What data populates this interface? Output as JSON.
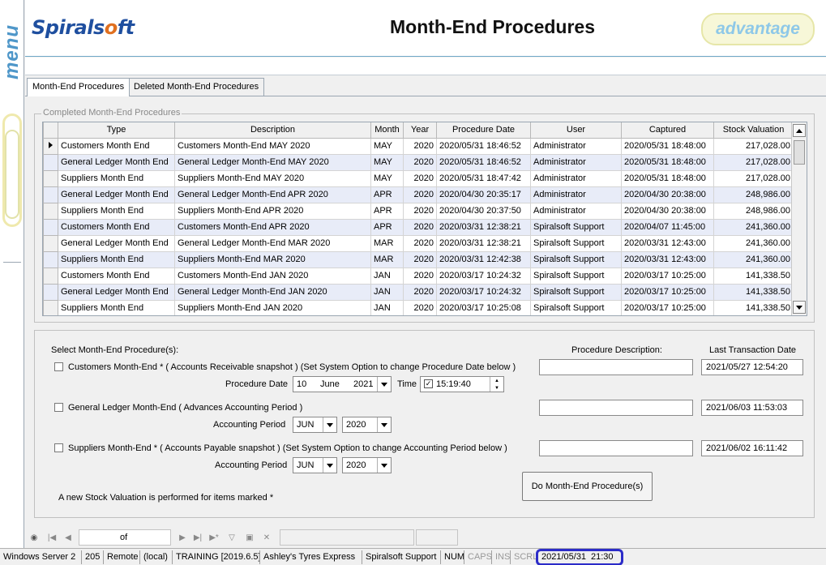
{
  "side_menu": {
    "label": "menu"
  },
  "header": {
    "logo_text_1": "Spirals",
    "logo_text_o": "o",
    "logo_text_2": "ft",
    "title": "Month-End Procedures",
    "right_logo": "advantage"
  },
  "tabs": [
    {
      "label": "Month-End Procedures",
      "active": true
    },
    {
      "label": "Deleted Month-End Procedures",
      "active": false
    }
  ],
  "completed": {
    "group_label": "Completed Month-End Procedures",
    "columns": [
      "Type",
      "Description",
      "Month",
      "Year",
      "Procedure Date",
      "User",
      "Captured",
      "Stock Valuation"
    ],
    "rows": [
      [
        "Customers Month End",
        "Customers Month-End MAY 2020",
        "MAY",
        "2020",
        "2020/05/31 18:46:52",
        "Administrator",
        "2020/05/31 18:48:00",
        "217,028.00"
      ],
      [
        "General Ledger Month End",
        "General Ledger Month-End MAY 2020",
        "MAY",
        "2020",
        "2020/05/31 18:46:52",
        "Administrator",
        "2020/05/31 18:48:00",
        "217,028.00"
      ],
      [
        "Suppliers Month End",
        "Suppliers Month-End MAY 2020",
        "MAY",
        "2020",
        "2020/05/31 18:47:42",
        "Administrator",
        "2020/05/31 18:48:00",
        "217,028.00"
      ],
      [
        "General Ledger Month End",
        "General Ledger Month-End APR 2020",
        "APR",
        "2020",
        "2020/04/30 20:35:17",
        "Administrator",
        "2020/04/30 20:38:00",
        "248,986.00"
      ],
      [
        "Suppliers Month End",
        "Suppliers Month-End APR 2020",
        "APR",
        "2020",
        "2020/04/30 20:37:50",
        "Administrator",
        "2020/04/30 20:38:00",
        "248,986.00"
      ],
      [
        "Customers Month End",
        "Customers Month-End APR 2020",
        "APR",
        "2020",
        "2020/03/31 12:38:21",
        "Spiralsoft Support",
        "2020/04/07 11:45:00",
        "241,360.00"
      ],
      [
        "General Ledger Month End",
        "General Ledger Month-End MAR 2020",
        "MAR",
        "2020",
        "2020/03/31 12:38:21",
        "Spiralsoft Support",
        "2020/03/31 12:43:00",
        "241,360.00"
      ],
      [
        "Suppliers Month End",
        "Suppliers Month-End MAR 2020",
        "MAR",
        "2020",
        "2020/03/31 12:42:38",
        "Spiralsoft Support",
        "2020/03/31 12:43:00",
        "241,360.00"
      ],
      [
        "Customers Month End",
        "Customers Month-End JAN 2020",
        "JAN",
        "2020",
        "2020/03/17 10:24:32",
        "Spiralsoft Support",
        "2020/03/17 10:25:00",
        "141,338.50"
      ],
      [
        "General Ledger Month End",
        "General Ledger Month-End JAN 2020",
        "JAN",
        "2020",
        "2020/03/17 10:24:32",
        "Spiralsoft Support",
        "2020/03/17 10:25:00",
        "141,338.50"
      ],
      [
        "Suppliers Month End",
        "Suppliers Month-End JAN 2020",
        "JAN",
        "2020",
        "2020/03/17 10:25:08",
        "Spiralsoft Support",
        "2020/03/17 10:25:00",
        "141,338.50"
      ]
    ]
  },
  "select": {
    "heading": "Select Month-End Procedure(s):",
    "desc_heading": "Procedure Description:",
    "last_tx_heading": "Last Transaction Date",
    "customers": {
      "label": "Customers Month-End *  ( Accounts Receivable snapshot )  (Set System Option to change Procedure Date below )",
      "date_label": "Procedure Date",
      "day": "10",
      "month": "June",
      "year": "2021",
      "time_label": "Time",
      "time": "15:19:40",
      "last_tx": "2021/05/27 12:54:20"
    },
    "gl": {
      "label": "General Ledger Month-End  ( Advances Accounting Period )",
      "period_label": "Accounting  Period",
      "month": "JUN",
      "year": "2020",
      "last_tx": "2021/06/03 11:53:03"
    },
    "suppliers": {
      "label": "Suppliers Month-End *  ( Accounts Payable snapshot )  (Set System Option to change Accounting Period below )",
      "period_label": "Accounting Period",
      "month": "JUN",
      "year": "2020",
      "last_tx": "2021/06/02 16:11:42"
    },
    "note": "A new Stock Valuation is performed for items marked *",
    "do_button": "Do Month-End Procedure(s)"
  },
  "navigator": {
    "of_label": "of"
  },
  "status": {
    "os": "Windows Server 2",
    "num": "205",
    "mode": "Remote",
    "server": "(local)",
    "db": "TRAINING [2019.6.5]",
    "company": "Ashley's Tyres Express",
    "user": "Spiralsoft Support",
    "num_lock": "NUM",
    "caps": "CAPS",
    "ins": "INS",
    "scrl": "SCRL",
    "date": "2021/05/31",
    "time": "21:30"
  }
}
